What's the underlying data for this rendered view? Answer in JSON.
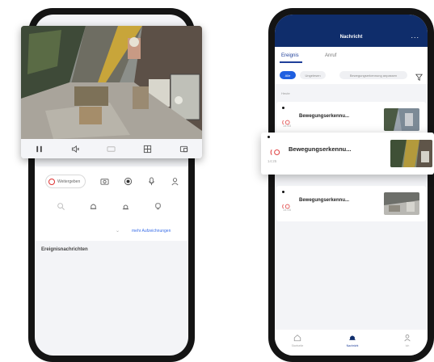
{
  "left_phone": {
    "extra_button_label": "Weitergeben",
    "more_link_label": "mehr Aufzeichnungen",
    "notifications_title": "Ereignisnachrichten"
  },
  "right_phone": {
    "header_title": "Nachricht",
    "header_more": "...",
    "tabs": [
      {
        "label": "Ereignis",
        "active": true
      },
      {
        "label": "Anruf",
        "active": false
      }
    ],
    "filters": [
      {
        "label": "Alle",
        "active": true
      },
      {
        "label": "Ungelesen",
        "active": false
      },
      {
        "label": "Bewegungserkennung anpassen",
        "active": false
      }
    ],
    "section_label": "Heute",
    "events": [
      {
        "title": "Bewegungserkennu...",
        "time": "14:53"
      },
      {
        "title": "Bewegungserkennu...",
        "time": "14:25"
      },
      {
        "title": "Bewegungserkennu...",
        "time": "14:16"
      }
    ],
    "bottom_nav": [
      {
        "label": "Startseite",
        "icon": "home-icon",
        "active": false
      },
      {
        "label": "Nachricht",
        "icon": "bell-icon",
        "active": true
      },
      {
        "label": "Ich",
        "icon": "user-icon",
        "active": false
      }
    ]
  },
  "colors": {
    "header_blue": "#0f2d6b",
    "accent_blue": "#1f5fe0",
    "motion_red": "#e04848"
  }
}
